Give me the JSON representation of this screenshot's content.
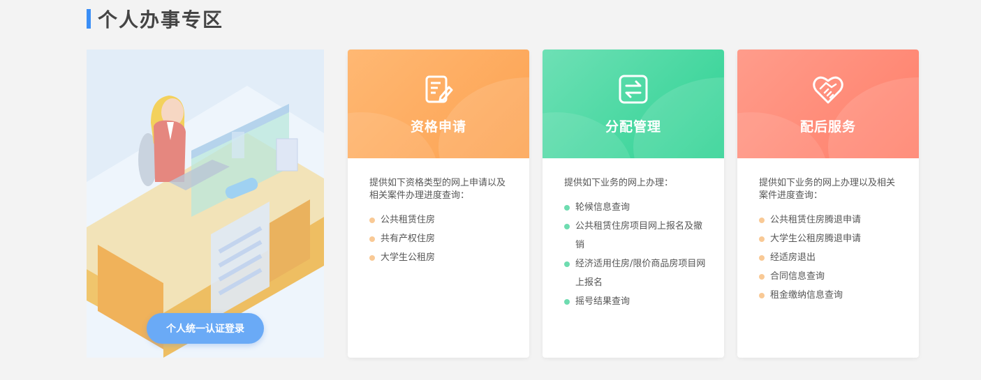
{
  "section": {
    "title": "个人办事专区",
    "accent": "#3a8ef6"
  },
  "login": {
    "label": "个人统一认证登录"
  },
  "cards": [
    {
      "title": "资格申请",
      "icon": "edit-document-icon",
      "color": "#fca251",
      "desc": "提供如下资格类型的网上申请以及相关案件办理进度查询：",
      "items": [
        "公共租赁住房",
        "共有产权住房",
        "大学生公租房"
      ]
    },
    {
      "title": "分配管理",
      "icon": "exchange-icon",
      "color": "#2ed293",
      "desc": "提供如下业务的网上办理：",
      "items": [
        "轮候信息查询",
        "公共租赁住房项目网上报名及撤销",
        "经济适用住房/限价商品房项目网上报名",
        "摇号结果查询"
      ]
    },
    {
      "title": "配后服务",
      "icon": "handshake-heart-icon",
      "color": "#ff7f6a",
      "desc": "提供如下业务的网上办理以及相关案件进度查询：",
      "items": [
        "公共租赁住房腾退申请",
        "大学生公租房腾退申请",
        "经适房退出",
        "合同信息查询",
        "租金缴纳信息查询"
      ]
    }
  ]
}
